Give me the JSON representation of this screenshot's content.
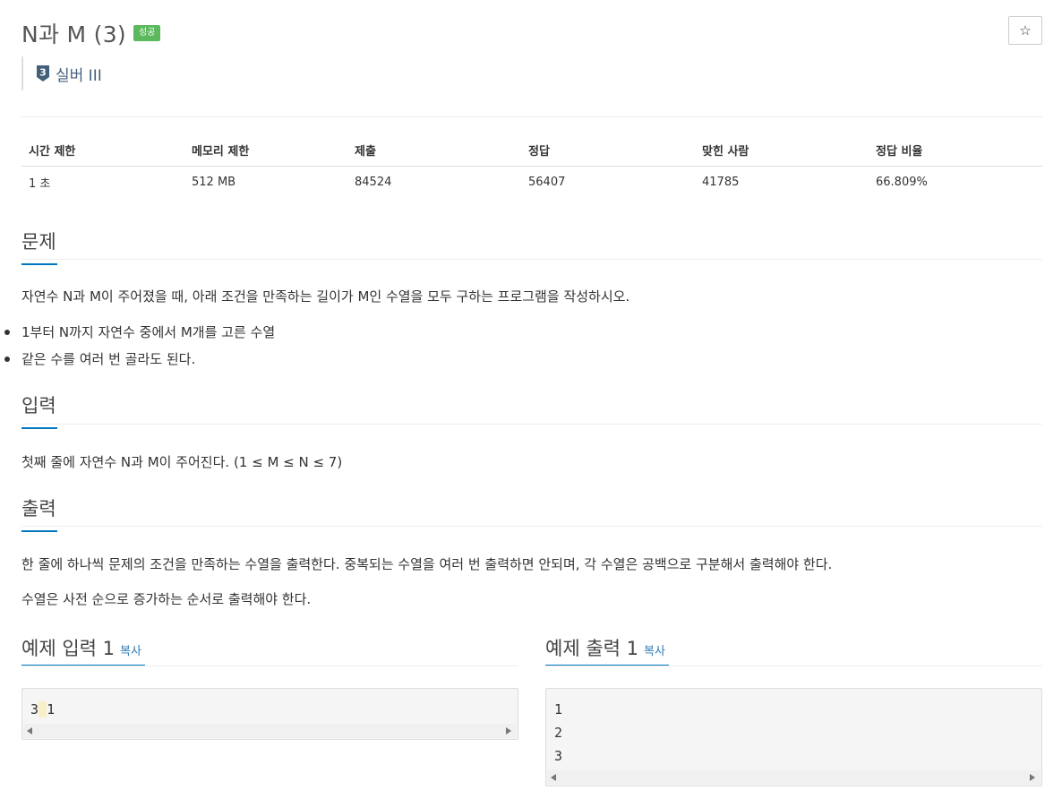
{
  "problem": {
    "title": "N과 M (3)",
    "status_badge": "성공",
    "star_icon": "☆",
    "tier": {
      "number": "3",
      "label": "실버 III"
    }
  },
  "stats": {
    "headers": [
      "시간 제한",
      "메모리 제한",
      "제출",
      "정답",
      "맞힌 사람",
      "정답 비율"
    ],
    "values": [
      "1 초",
      "512 MB",
      "84524",
      "56407",
      "41785",
      "66.809%"
    ]
  },
  "sections": {
    "description": {
      "heading": "문제",
      "intro": "자연수 N과 M이 주어졌을 때, 아래 조건을 만족하는 길이가 M인 수열을 모두 구하는 프로그램을 작성하시오.",
      "bullets": [
        "1부터 N까지 자연수 중에서 M개를 고른 수열",
        "같은 수를 여러 번 골라도 된다."
      ]
    },
    "input": {
      "heading": "입력",
      "text": "첫째 줄에 자연수 N과 M이 주어진다. (1 ≤ M ≤ N ≤ 7)"
    },
    "output": {
      "heading": "출력",
      "text1": "한 줄에 하나씩 문제의 조건을 만족하는 수열을 출력한다. 중복되는 수열을 여러 번 출력하면 안되며, 각 수열은 공백으로 구분해서 출력해야 한다.",
      "text2": "수열은 사전 순으로 증가하는 순서로 출력해야 한다."
    }
  },
  "examples": {
    "input1": {
      "heading": "예제 입력 1",
      "copy": "복사",
      "first": "3",
      "space": " ",
      "second": "1"
    },
    "output1": {
      "heading": "예제 출력 1",
      "copy": "복사",
      "lines": "1\n2\n3"
    }
  },
  "colors": {
    "accent": "#0076c0",
    "success": "#5cb85c",
    "tier": "#435f7a"
  }
}
